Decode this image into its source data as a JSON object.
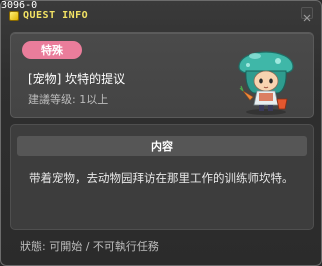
{
  "quest_id": "3096-0",
  "window": {
    "title": "QUEST INFO"
  },
  "quest": {
    "category_badge": "特殊",
    "name": "[宠物] 坎特的提议",
    "level": "建議等级: 1以上"
  },
  "content": {
    "header": "内容",
    "text": "带着宠物，去动物园拜访在那里工作的训练师坎特。"
  },
  "status": "狀態: 可開始 / 不可執行任務",
  "colors": {
    "title_yellow": "#f2e264",
    "badge_pink": "#ea7d9b",
    "npc_teal": "#3fb7a8"
  },
  "icons": [
    "quest-info-icon",
    "close-icon",
    "npc-portrait"
  ]
}
